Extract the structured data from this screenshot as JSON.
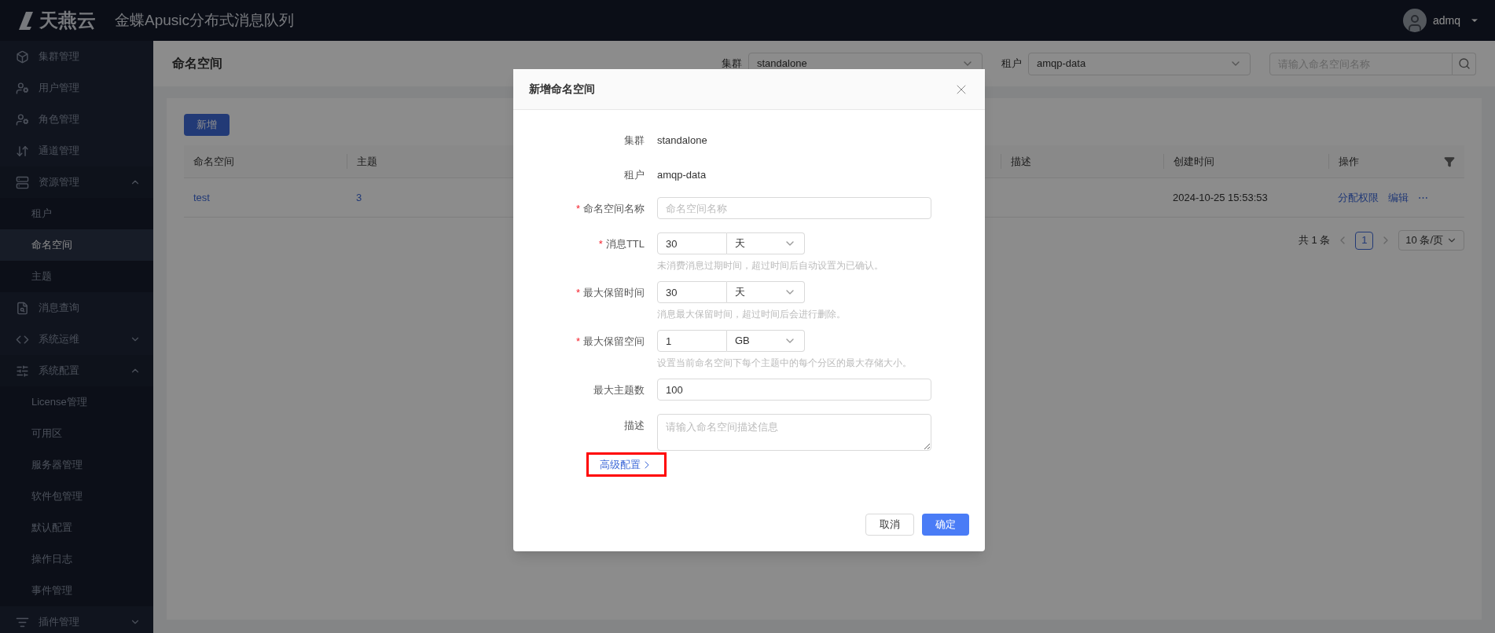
{
  "header": {
    "logo_text": "天燕云",
    "app_title": "金蝶Apusic分布式消息队列",
    "user": "admq"
  },
  "sidebar": {
    "items": [
      {
        "label": "集群管理",
        "kind": "item",
        "selected": false
      },
      {
        "label": "用户管理",
        "kind": "item",
        "selected": false
      },
      {
        "label": "角色管理",
        "kind": "item",
        "selected": false
      },
      {
        "label": "通道管理",
        "kind": "item",
        "selected": false
      },
      {
        "label": "资源管理",
        "kind": "group",
        "expanded": true,
        "children": [
          {
            "label": "租户",
            "selected": false
          },
          {
            "label": "命名空间",
            "selected": true
          },
          {
            "label": "主题",
            "selected": false
          }
        ]
      },
      {
        "label": "消息查询",
        "kind": "item",
        "selected": false
      },
      {
        "label": "系统运维",
        "kind": "group",
        "expanded": false
      },
      {
        "label": "系统配置",
        "kind": "group",
        "expanded": true,
        "children": [
          {
            "label": "License管理",
            "selected": false
          },
          {
            "label": "可用区",
            "selected": false
          },
          {
            "label": "服务器管理",
            "selected": false
          },
          {
            "label": "软件包管理",
            "selected": false
          },
          {
            "label": "默认配置",
            "selected": false
          },
          {
            "label": "操作日志",
            "selected": false
          },
          {
            "label": "事件管理",
            "selected": false
          }
        ]
      },
      {
        "label": "插件管理",
        "kind": "group",
        "expanded": false
      }
    ]
  },
  "page": {
    "title": "命名空间",
    "filters": [
      {
        "label": "集群",
        "value": "standalone"
      },
      {
        "label": "租户",
        "value": "amqp-data"
      }
    ],
    "search": {
      "placeholder": "请输入命名空间名称"
    },
    "new_button": "新增",
    "table": {
      "columns": [
        "命名空间",
        "主题",
        "",
        "描述",
        "创建时间",
        "操作"
      ],
      "rows": [
        {
          "cells": [
            "test",
            "3",
            "",
            "",
            "2024-10-25 15:53:53"
          ],
          "actions": [
            "分配权限",
            "编辑",
            "⋯"
          ]
        }
      ]
    },
    "pagination": {
      "total": "共 1 条",
      "pages": [
        {
          "label": "1",
          "selected": true
        }
      ],
      "page_size": "10 条/页"
    }
  },
  "dialog": {
    "title": "新增命名空间",
    "required_mark": "*",
    "fields": [
      {
        "kind": "static",
        "label": "集群",
        "required": false,
        "value": "standalone"
      },
      {
        "kind": "static",
        "label": "租户",
        "required": false,
        "value": "amqp-data"
      },
      {
        "kind": "text",
        "label": "命名空间名称",
        "required": true,
        "placeholder": "命名空间名称"
      },
      {
        "kind": "unit",
        "label": "消息TTL",
        "required": true,
        "value": "30",
        "unit": "天",
        "hint": "未消费消息过期时间，超过时间后自动设置为已确认。"
      },
      {
        "kind": "unit",
        "label": "最大保留时间",
        "required": true,
        "value": "30",
        "unit": "天",
        "hint": "消息最大保留时间，超过时间后会进行删除。"
      },
      {
        "kind": "unit",
        "label": "最大保留空间",
        "required": true,
        "value": "1",
        "unit": "GB",
        "hint": "设置当前命名空间下每个主题中的每个分区的最大存储大小。"
      },
      {
        "kind": "text",
        "label": "最大主题数",
        "required": false,
        "value": "100"
      },
      {
        "kind": "textarea",
        "label": "描述",
        "required": false,
        "placeholder": "请输入命名空间描述信息"
      }
    ],
    "advanced_link": {
      "label": "高级配置",
      "highlighted": true
    },
    "buttons": [
      {
        "label": "取消",
        "kind": "secondary"
      },
      {
        "label": "确定",
        "kind": "primary"
      }
    ]
  }
}
